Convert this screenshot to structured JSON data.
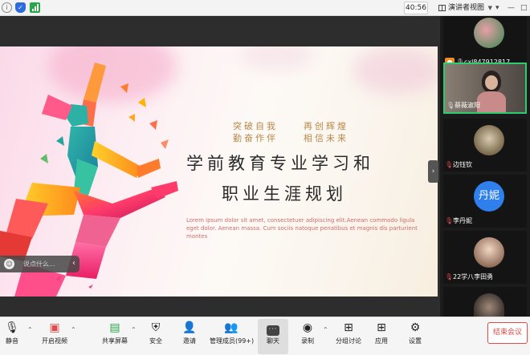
{
  "topbar": {
    "timer": "40:56",
    "view_label": "演讲者视图",
    "win_minimize": "—",
    "win_maximize": "□",
    "win_more": "▾"
  },
  "slide": {
    "slogan_left": [
      "突破自我",
      "勤奋作伴"
    ],
    "slogan_right": [
      "再创辉煌",
      "相信未来"
    ],
    "title_line1": "学前教育专业学习和",
    "title_line2": "职业生涯规划",
    "lorem": "Lorem ipsum dolor sit amet, consectetuer adipiscing elit.Aenean commodo ligula eget dolor. Aenean massa. Cum sociis natoque penatibus et magnis dis parturient montes"
  },
  "comment_box": {
    "placeholder": "说点什么..."
  },
  "participants": [
    {
      "name": "cxl847912817",
      "mic": "on",
      "active": false
    },
    {
      "name": "蔡薇淑阳",
      "mic": "on",
      "active": true
    },
    {
      "name": "边钰钦",
      "mic": "muted",
      "active": false
    },
    {
      "name": "李丹妮",
      "mic": "muted",
      "active": false,
      "avatar_text": "丹妮"
    },
    {
      "name": "22学八李田勇",
      "mic": "muted",
      "active": false
    },
    {
      "name": "",
      "mic": "muted",
      "active": false
    }
  ],
  "toolbar": {
    "mute": "静音",
    "video": "开启视频",
    "share": "共享屏幕",
    "security": "安全",
    "invite": "邀请",
    "members": "管理成员(99+)",
    "chat": "聊天",
    "record": "录制",
    "breakout": "分组讨论",
    "apps": "应用",
    "settings": "设置",
    "end": "结束会议"
  },
  "colors": {
    "accent_green": "#2ecc71",
    "end_red": "#e14b4b",
    "slogan_gold": "#b8884a",
    "lorem_red": "#d46b6b"
  }
}
